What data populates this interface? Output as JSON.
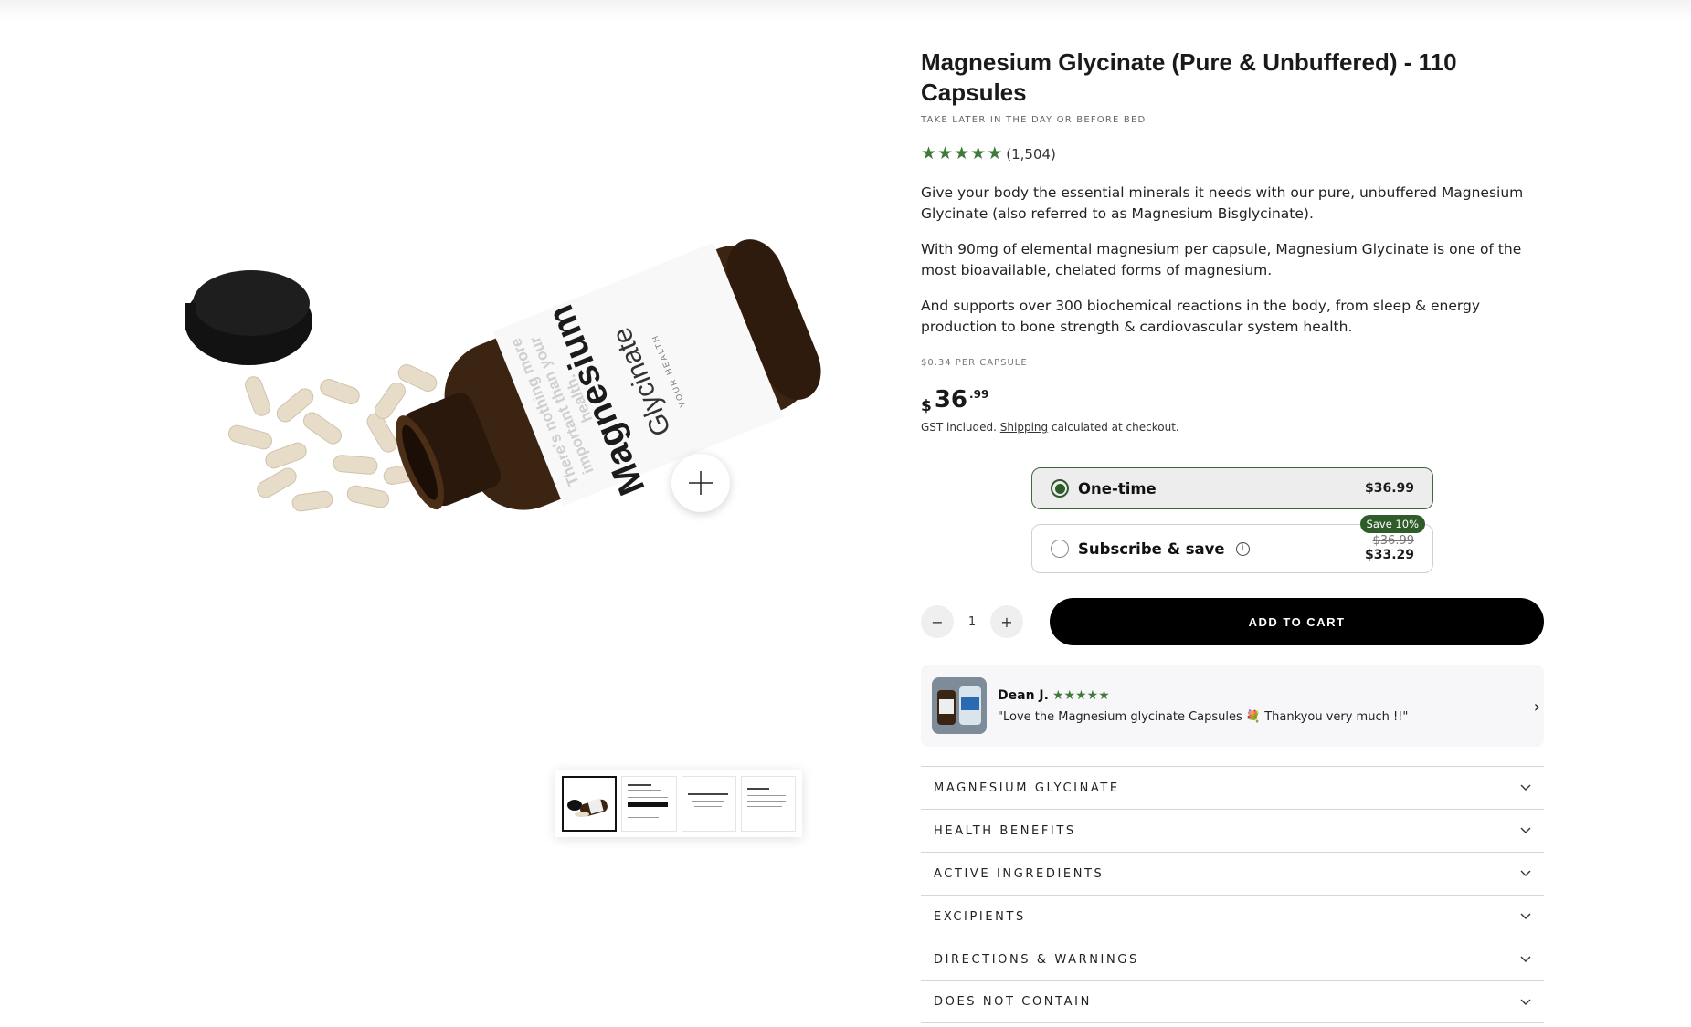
{
  "product": {
    "title": "Magnesium Glycinate (Pure & Unbuffered) - 110 Capsules",
    "subtitle": "TAKE LATER IN THE DAY OR BEFORE BED",
    "rating": {
      "stars": 5,
      "count": "(1,504)"
    },
    "description": [
      "Give your body the essential minerals it needs with our pure, unbuffered Magnesium Glycinate (also referred to as Magnesium Bisglycinate).",
      "With 90mg of elemental magnesium per capsule, Magnesium Glycinate is one of the most bioavailable, chelated forms of magnesium.",
      "And supports over 300 biochemical reactions in the body, from sleep & energy production to bone strength & cardiovascular system health."
    ],
    "per_capsule": "$0.34 PER CAPSULE",
    "price": {
      "currency": "$",
      "main": "36",
      "cents": ".99"
    },
    "tax_note": {
      "before": "GST included. ",
      "link": "Shipping",
      "after": " calculated at checkout."
    }
  },
  "purchase_options": {
    "one_time": {
      "label": "One-time",
      "price": "$36.99",
      "selected": true
    },
    "subscribe": {
      "label": "Subscribe & save",
      "badge": "Save 10%",
      "old_price": "$36.99",
      "new_price": "$33.29",
      "selected": false
    }
  },
  "quantity": {
    "minus": "−",
    "value": "1",
    "plus": "+"
  },
  "add_to_cart": "ADD TO CART",
  "review": {
    "name": "Dean J.",
    "stars": 5,
    "text": "\"Love the Magnesium glycinate Capsules 💐 Thankyou very much !!\""
  },
  "accordion": [
    "MAGNESIUM GLYCINATE",
    "HEALTH BENEFITS",
    "ACTIVE INGREDIENTS",
    "EXCIPIENTS",
    "DIRECTIONS & WARNINGS",
    "DOES NOT CONTAIN"
  ],
  "gallery": {
    "label_brand": "Magnesium",
    "label_product": "Glycinate",
    "label_sub": "YOUR HEALTH",
    "label_tagline_1": "There's nothing more",
    "label_tagline_2": "important than your",
    "label_tagline_3": "health.",
    "thumb_count": 4
  },
  "colors": {
    "star_green": "#3f7a3a",
    "accent_green": "#2e5d2a",
    "button_black": "#000000"
  }
}
